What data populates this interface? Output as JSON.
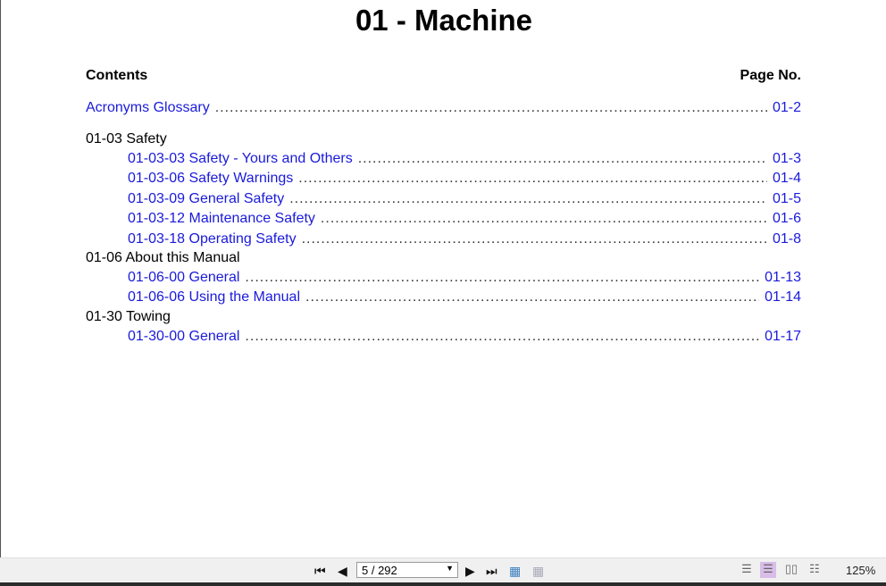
{
  "title": "01 - Machine",
  "contents_label": "Contents",
  "page_no_label": "Page No.",
  "entries": [
    {
      "label": "Acronyms Glossary",
      "page": "01-2"
    },
    {
      "section": "01-03 Safety"
    },
    {
      "label": "01-03-03 Safety - Yours and Others",
      "page": "01-3"
    },
    {
      "label": "01-03-06 Safety Warnings",
      "page": "01-4"
    },
    {
      "label": "01-03-09 General Safety",
      "page": "01-5"
    },
    {
      "label": "01-03-12 Maintenance Safety",
      "page": "01-6"
    },
    {
      "label": "01-03-18 Operating Safety",
      "page": "01-8"
    },
    {
      "section": "01-06 About this Manual"
    },
    {
      "label": "01-06-00 General",
      "page": "01-13"
    },
    {
      "label": "01-06-06 Using the Manual",
      "page": "01-14"
    },
    {
      "section": "01-30 Towing"
    },
    {
      "label": "01-30-00 General",
      "page": "01-17"
    }
  ],
  "toolbar": {
    "page_indicator": "5 / 292",
    "zoom": "125%"
  }
}
